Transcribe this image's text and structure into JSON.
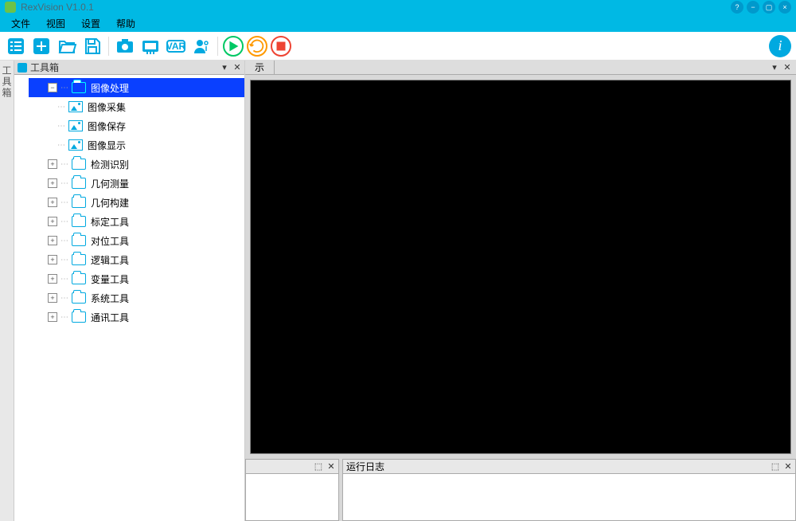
{
  "app_title": "RexVision V1.0.1",
  "menu": {
    "file": "文件",
    "view": "视图",
    "settings": "设置",
    "help": "帮助"
  },
  "toolbar": {
    "list": "list",
    "new": "new",
    "open": "open",
    "save": "save",
    "camera": "camera",
    "io": "io",
    "var": "VAR",
    "user": "user",
    "run": "run",
    "loop": "loop",
    "stop": "stop",
    "info": "i"
  },
  "side_tab_label": "工具箱",
  "toolbox": {
    "title": "工具箱",
    "nodes": [
      {
        "label": "图像处理",
        "expanded": true,
        "selected": true,
        "icon": "folder",
        "level": 0,
        "children": [
          {
            "label": "图像采集",
            "icon": "image",
            "level": 1
          },
          {
            "label": "图像保存",
            "icon": "image",
            "level": 1
          },
          {
            "label": "图像显示",
            "icon": "image",
            "level": 1
          }
        ]
      },
      {
        "label": "检测识别",
        "expanded": false,
        "icon": "folder",
        "level": 0
      },
      {
        "label": "几何测量",
        "expanded": false,
        "icon": "folder",
        "level": 0
      },
      {
        "label": "几何构建",
        "expanded": false,
        "icon": "folder",
        "level": 0
      },
      {
        "label": "标定工具",
        "expanded": false,
        "icon": "folder",
        "level": 0
      },
      {
        "label": "对位工具",
        "expanded": false,
        "icon": "folder",
        "level": 0
      },
      {
        "label": "逻辑工具",
        "expanded": false,
        "icon": "folder",
        "level": 0
      },
      {
        "label": "变量工具",
        "expanded": false,
        "icon": "folder",
        "level": 0
      },
      {
        "label": "系统工具",
        "expanded": false,
        "icon": "folder",
        "level": 0
      },
      {
        "label": "通讯工具",
        "expanded": false,
        "icon": "folder",
        "level": 0
      }
    ]
  },
  "viewer_tab": "示",
  "bottom": {
    "left_title": "",
    "right_title": "运行日志"
  },
  "panel_ctrls": {
    "pin": "📌",
    "dropdown": "▾",
    "close": "✕"
  }
}
